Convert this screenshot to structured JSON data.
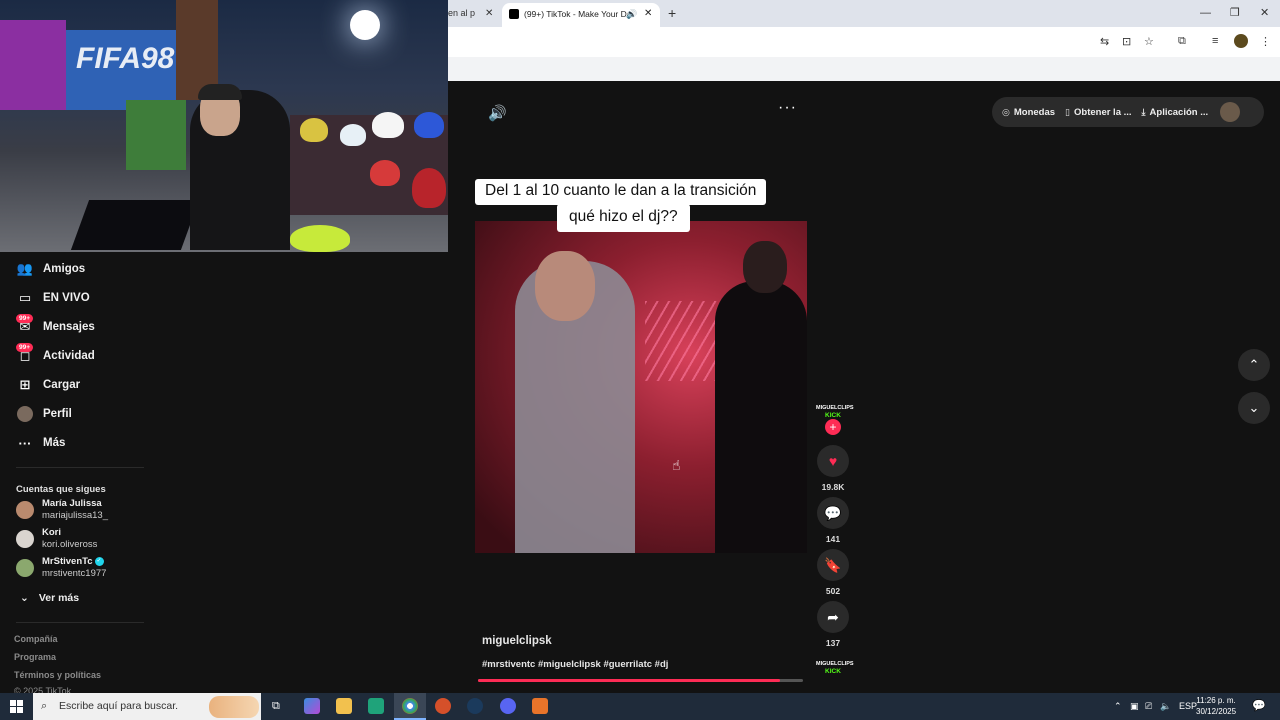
{
  "browser": {
    "prev_tab_label": "en al p",
    "active_tab_label": "(99+) TikTok - Make Your Da",
    "new_tab": "+",
    "minimize": "—",
    "restore": "❐",
    "close": "✕"
  },
  "sidebar": {
    "items": [
      {
        "label": "Amigos",
        "icon": "people-icon"
      },
      {
        "label": "EN VIVO",
        "icon": "live-icon"
      },
      {
        "label": "Mensajes",
        "icon": "messages-icon",
        "badge": "99+"
      },
      {
        "label": "Actividad",
        "icon": "activity-icon",
        "badge": "99+"
      },
      {
        "label": "Cargar",
        "icon": "upload-icon"
      },
      {
        "label": "Perfil",
        "icon": "profile-avatar"
      },
      {
        "label": "Más",
        "icon": "more-icon"
      }
    ],
    "following_title": "Cuentas que sigues",
    "accounts": [
      {
        "name": "María Julissa",
        "username": "mariajulissa13_"
      },
      {
        "name": "Kori",
        "username": "kori.oliveross"
      },
      {
        "name": "MrStivenTc",
        "username": "mrstiventc1977",
        "verified": true
      }
    ],
    "see_more": "Ver más",
    "footer": [
      "Compañía",
      "Programa",
      "Términos y políticas",
      "© 2025 TikTok"
    ]
  },
  "topbar": {
    "coins": "Monedas",
    "get_coins": "Obtener la ...",
    "app": "Aplicación ..."
  },
  "video": {
    "caption_line1": "Del 1 al 10 cuanto le dan a la transición",
    "caption_line2": "qué hizo el dj??",
    "author": "miguelclipsk",
    "hashtags": "#mrstiventc #miguelclipsk #guerrilatc #dj",
    "progress": 0.93
  },
  "actions": {
    "creator_logo_top": "MIGUELCLIPS",
    "creator_logo_bottom": "KICK",
    "likes": "19.8K",
    "comments": "141",
    "saves": "502",
    "shares": "137"
  },
  "taskbar": {
    "search_placeholder": "Escribe aquí para buscar.",
    "language": "ESP",
    "time": "11:26 p. m.",
    "date": "30/12/2025"
  }
}
